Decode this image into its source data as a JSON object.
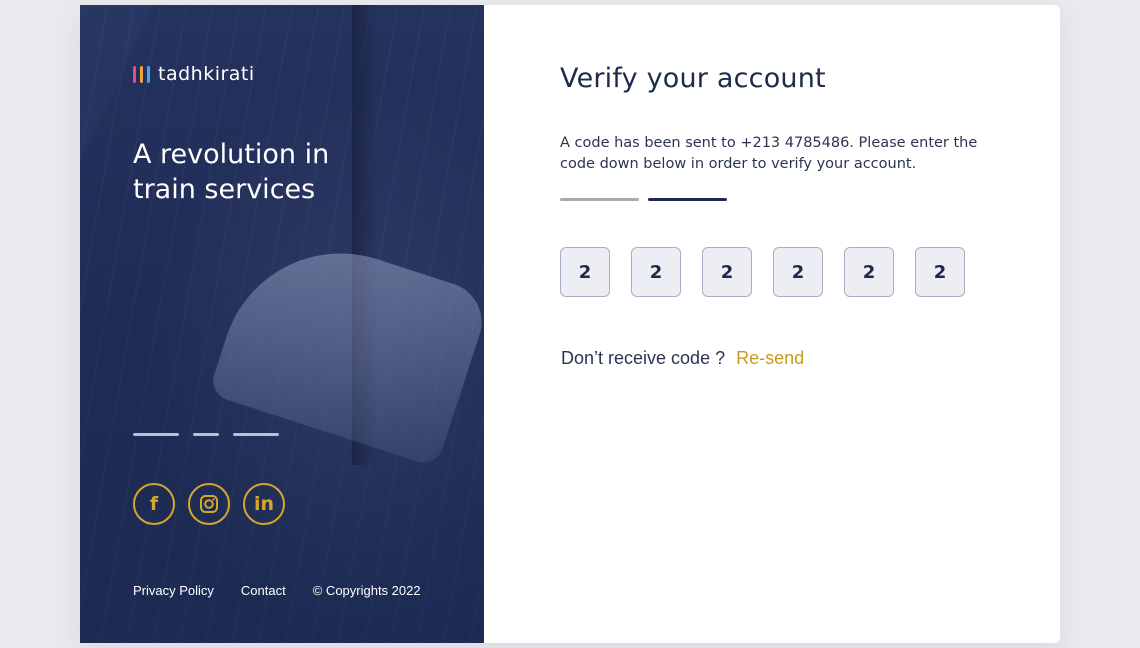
{
  "brand": {
    "name": "tadhkirati",
    "bar_colors": [
      "#e34b8a",
      "#f2a23a",
      "#3fa6e8"
    ]
  },
  "hero": {
    "tagline": "A revolution in train services"
  },
  "socials": [
    {
      "icon": "facebook-icon",
      "glyph": "f"
    },
    {
      "icon": "instagram-icon",
      "glyph": ""
    },
    {
      "icon": "linkedin-icon",
      "glyph": "in"
    }
  ],
  "footer": {
    "privacy": "Privacy Policy",
    "contact": "Contact",
    "copyright": "© Copyrights 2022"
  },
  "verify": {
    "title": "Verify your account",
    "description": "A code has been sent to +213 4785486.  Please enter the code down below in order to verify your account.",
    "steps_total": 2,
    "steps_current": 2,
    "code_digits": [
      "2",
      "2",
      "2",
      "2",
      "2",
      "2"
    ],
    "resend_prompt": "Don’t receive code ?",
    "resend_link": "Re-send"
  },
  "colors": {
    "accent_gold": "#d4a62a",
    "link_gold": "#c99a1e",
    "navy": "#1d2a4a",
    "step_done": "#1d2a4a",
    "step_pending": "#a9aab0"
  }
}
